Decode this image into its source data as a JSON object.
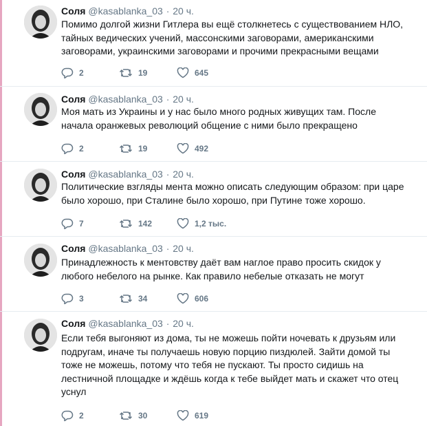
{
  "tweets": [
    {
      "name": "Соля",
      "handle": "@kasablanka_03",
      "separator": "·",
      "time": "20 ч.",
      "text": "Помимо долгой жизни Гитлера вы ещё столкнетесь с существованием НЛО,\nтайных ведических учений, массонскими заговорами, американскими\nзаговорами, украинскими заговорами и прочими прекрасными вещами",
      "replies": "2",
      "retweets": "19",
      "likes": "645"
    },
    {
      "name": "Соля",
      "handle": "@kasablanka_03",
      "separator": "·",
      "time": "20 ч.",
      "text": "Моя мать из Украины и у нас было много родных живущих там. После\nначала оранжевых революций общение с ними было прекращено",
      "replies": "2",
      "retweets": "19",
      "likes": "492"
    },
    {
      "name": "Соля",
      "handle": "@kasablanka_03",
      "separator": "·",
      "time": "20 ч.",
      "text": "Политические взгляды мента можно описать следующим образом: при царе\nбыло хорошо, при Сталине было хорошо, при Путине тоже хорошо.",
      "replies": "7",
      "retweets": "142",
      "likes": "1,2 тыс."
    },
    {
      "name": "Соля",
      "handle": "@kasablanka_03",
      "separator": "·",
      "time": "20 ч.",
      "text": "Принадлежность к ментовству даёт вам наглое право просить скидок у\nлюбого небелого на рынке. Как правило небелые отказать не могут",
      "replies": "3",
      "retweets": "34",
      "likes": "606"
    },
    {
      "name": "Соля",
      "handle": "@kasablanka_03",
      "separator": "·",
      "time": "20 ч.",
      "text": "Если тебя выгоняют из дома, ты не можешь пойти ночевать к друзьям или\nподругам, иначе ты получаешь новую порцию пиздюлей. Зайти домой ты\nтоже не можешь, потому что тебя не пускают. Ты просто сидишь на\nлестничной площадке и ждёшь когда к тебе выйдет мать и скажет что отец\nуснул",
      "replies": "2",
      "retweets": "30",
      "likes": "619"
    }
  ],
  "icons": {
    "reply": "reply-icon",
    "retweet": "retweet-icon",
    "like": "heart-icon"
  },
  "colors": {
    "thread_line": "#e6a6c0",
    "secondary_text": "#657786"
  }
}
